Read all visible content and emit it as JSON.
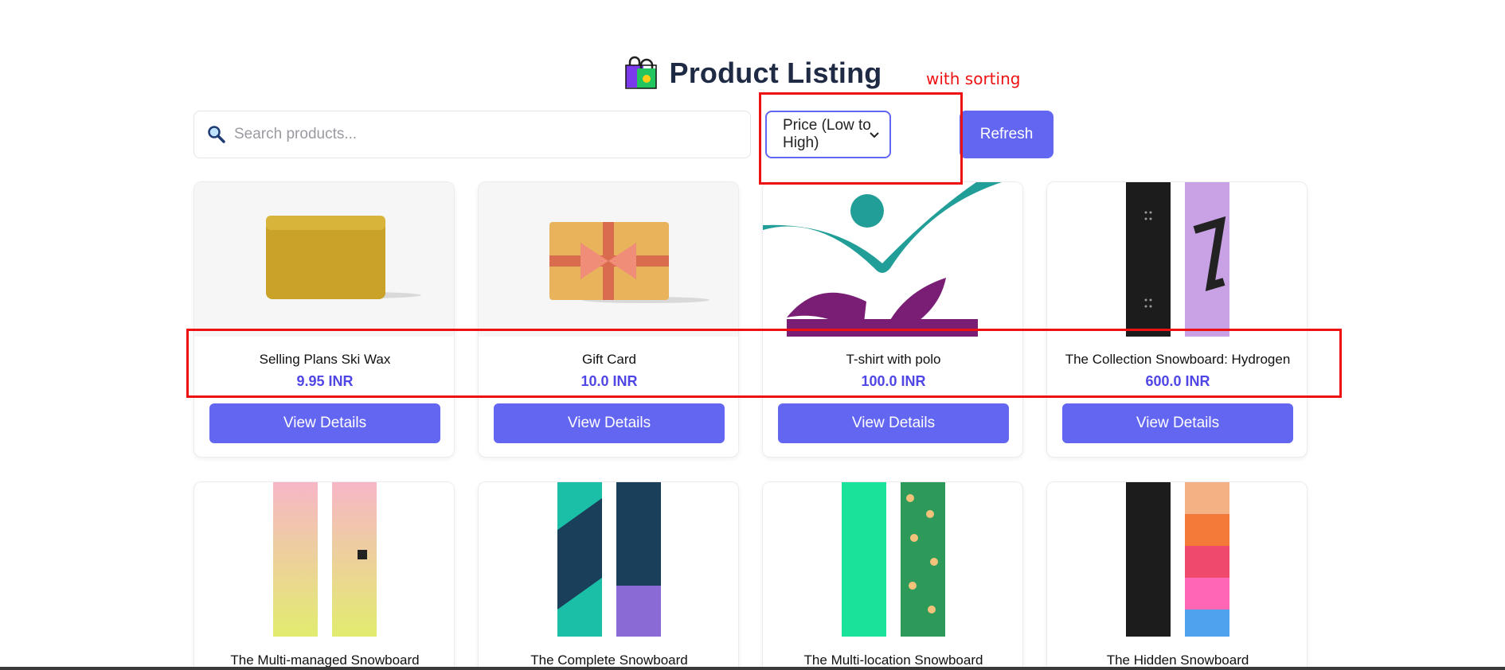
{
  "header": {
    "title": "Product Listing",
    "logo_icon": "shopping-bags-icon"
  },
  "search": {
    "placeholder": "Search products...",
    "value": "",
    "icon": "magnifier-icon"
  },
  "sort": {
    "selected": "Price (Low to High)"
  },
  "refresh": {
    "label": "Refresh"
  },
  "annotation": {
    "note": "with sorting",
    "color": "#ee1111"
  },
  "accent": "#6366f1",
  "products": [
    {
      "name": "Selling Plans Ski Wax",
      "price": "9.95 INR",
      "button": "View Details",
      "image": "ski-wax"
    },
    {
      "name": "Gift Card",
      "price": "10.0 INR",
      "button": "View Details",
      "image": "gift-card"
    },
    {
      "name": "T-shirt with polo",
      "price": "100.0 INR",
      "button": "View Details",
      "image": "logo-leaf"
    },
    {
      "name": "The Collection Snowboard: Hydrogen",
      "price": "600.0 INR",
      "button": "View Details",
      "image": "snowboard-hydrogen"
    },
    {
      "name": "The Multi-managed Snowboard",
      "image": "snowboard-multi-managed"
    },
    {
      "name": "The Complete Snowboard",
      "image": "snowboard-complete"
    },
    {
      "name": "The Multi-location Snowboard",
      "image": "snowboard-multi-location"
    },
    {
      "name": "The Hidden Snowboard",
      "image": "snowboard-hidden"
    }
  ]
}
